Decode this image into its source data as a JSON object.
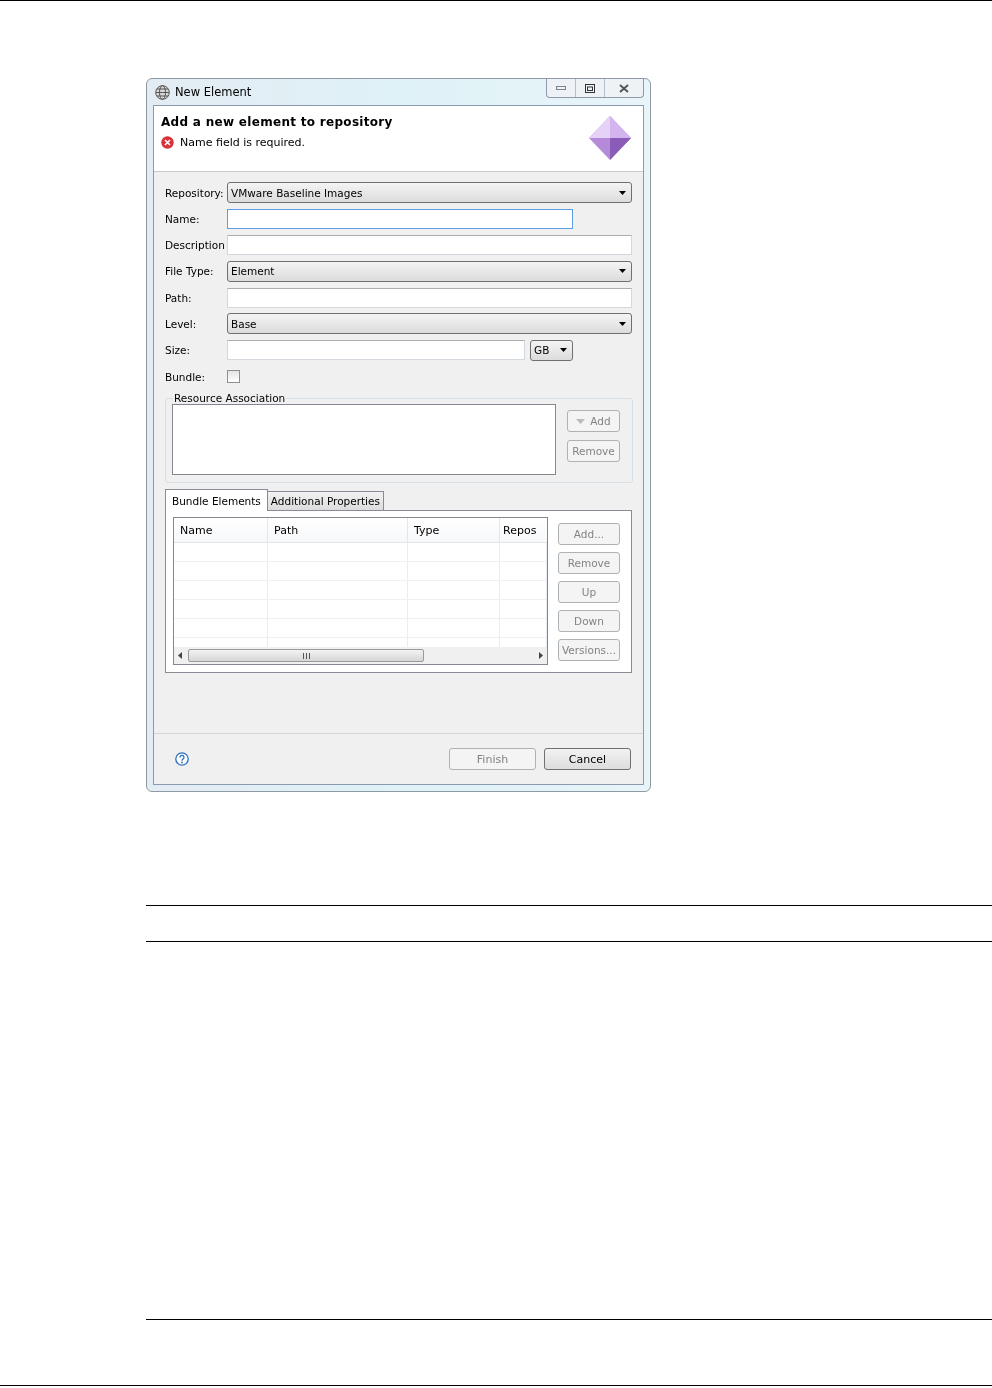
{
  "window": {
    "title": "New Element"
  },
  "header": {
    "title": "Add a new element to repository",
    "message": "Name field is required."
  },
  "fields": [
    {
      "kind": "combo",
      "label": "Repository:",
      "value": "VMware Baseline Images"
    },
    {
      "kind": "text-narrow",
      "label": "Name:",
      "focused": true
    },
    {
      "kind": "text",
      "label": "Description",
      "focused": false
    },
    {
      "kind": "combo",
      "label": "File Type:",
      "value": "Element"
    },
    {
      "kind": "text",
      "label": "Path:",
      "focused": false
    },
    {
      "kind": "combo",
      "label": "Level:",
      "value": "Base"
    },
    {
      "kind": "size",
      "label": "Size:",
      "unit": "GB",
      "focused": false
    },
    {
      "kind": "checkbox",
      "label": "Bundle:",
      "checked": false
    }
  ],
  "resource_association": {
    "title": "Resource Association",
    "buttons": [
      {
        "label": "Add",
        "kind": "menu",
        "disabled": true
      },
      {
        "label": "Remove",
        "kind": "plain",
        "disabled": true
      }
    ]
  },
  "tabs": [
    {
      "label": "Bundle Elements",
      "selected": true
    },
    {
      "label": "Additional Properties",
      "selected": false
    }
  ],
  "table": {
    "columns": [
      "Name",
      "Path",
      "Type",
      "Repos"
    ]
  },
  "table_buttons": [
    {
      "label": "Add...",
      "disabled": true
    },
    {
      "label": "Remove",
      "disabled": true
    },
    {
      "label": "Up",
      "disabled": true
    },
    {
      "label": "Down",
      "disabled": true
    },
    {
      "label": "Versions...",
      "disabled": true
    }
  ],
  "footer": {
    "buttons": [
      {
        "label": "Finish",
        "disabled": true
      },
      {
        "label": "Cancel",
        "disabled": false
      }
    ]
  }
}
